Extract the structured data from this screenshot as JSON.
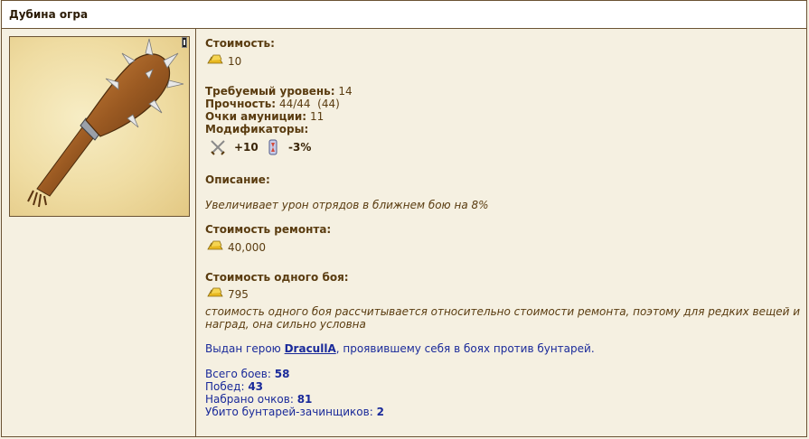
{
  "title": "Дубина огра",
  "cost": {
    "label": "Стоимость:",
    "value": "10"
  },
  "stats": {
    "level_label": "Требуемый уровень:",
    "level_value": "14",
    "durability_label": "Прочность:",
    "durability_value": "44/44  (44)",
    "ammo_label": "Очки амуниции:",
    "ammo_value": "11",
    "modifiers_label": "Модификаторы:",
    "modifiers": [
      {
        "icon": "crossed-swords-icon",
        "value": "+10"
      },
      {
        "icon": "hourglass-icon",
        "value": "-3%"
      }
    ]
  },
  "description": {
    "label": "Описание:",
    "text": "Увеличивает урон отрядов в ближнем бою на 8%"
  },
  "repair": {
    "label": "Стоимость ремонта:",
    "value": "40,000"
  },
  "battle_cost": {
    "label": "Стоимость одного боя:",
    "value": "795",
    "note_line1": "стоимость одного боя рассчитывается относительно стоимости ремонта, поэтому для редких вещей и",
    "note_line2": "наград, она сильно условна"
  },
  "award": {
    "prefix": "Выдан герою ",
    "hero": "DracullA",
    "suffix": ", проявившему себя в боях против бунтарей."
  },
  "counters": [
    {
      "label": "Всего боев: ",
      "value": "58"
    },
    {
      "label": "Побед: ",
      "value": "43"
    },
    {
      "label": "Набрано очков: ",
      "value": "81"
    },
    {
      "label": "Убито бунтарей-зачинщиков: ",
      "value": "2"
    }
  ],
  "colors": {
    "background": "#f5f0e1",
    "border": "#6b5334",
    "text": "#5a3c10",
    "link": "#1a2a9a"
  }
}
